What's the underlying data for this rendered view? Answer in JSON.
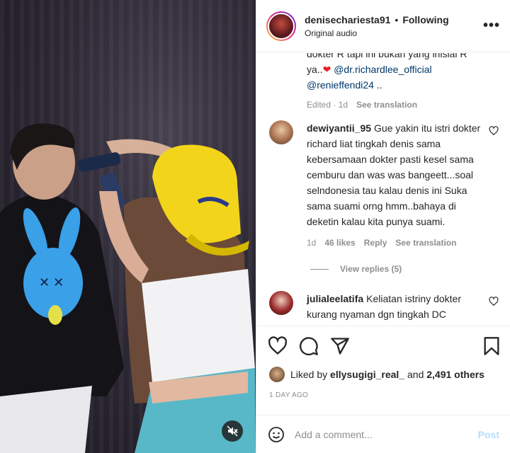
{
  "header": {
    "username": "denisechariesta91",
    "separator": "•",
    "follow_status": "Following",
    "subtitle": "Original audio",
    "more_label": "•••"
  },
  "caption": {
    "line_top": "dokter R tapi ini bukan yang inisial R",
    "line_start": "ya..",
    "heart": "❤",
    "mention1": "@dr.richardlee_official",
    "mention2": "@renieffendi24",
    "tail": " ..",
    "edited": "Edited",
    "age": "1d",
    "see_translation": "See translation"
  },
  "comments": [
    {
      "username": "dewiyantii_95",
      "text": "Gue yakin itu istri dokter richard liat tingkah denis sama kebersamaan dokter pasti kesel sama cemburu dan was was bangeett...soal selndonesia tau kalau denis ini Suka sama suami orng hmm..bahaya di deketin kalau kita punya suami.",
      "age": "1d",
      "likes": "46 likes",
      "reply": "Reply",
      "see_translation": "See translation",
      "view_replies": "View replies (5)"
    },
    {
      "username": "julialeelatifa",
      "text": "Keliatan istriny dokter kurang nyaman dgn tingkah DC"
    }
  ],
  "likes": {
    "prefix": "Liked by",
    "user": "ellysugigi_real_",
    "middle": "and",
    "count": "2,491 others"
  },
  "date": "1 DAY AGO",
  "add_comment": {
    "placeholder": "Add a comment...",
    "post_label": "Post"
  },
  "colors": {
    "accent": "#0095f6",
    "post_disabled": "#b2dffc",
    "mention": "#00376b",
    "muted": "#8e8e8e",
    "heart": "#ed1c24"
  }
}
